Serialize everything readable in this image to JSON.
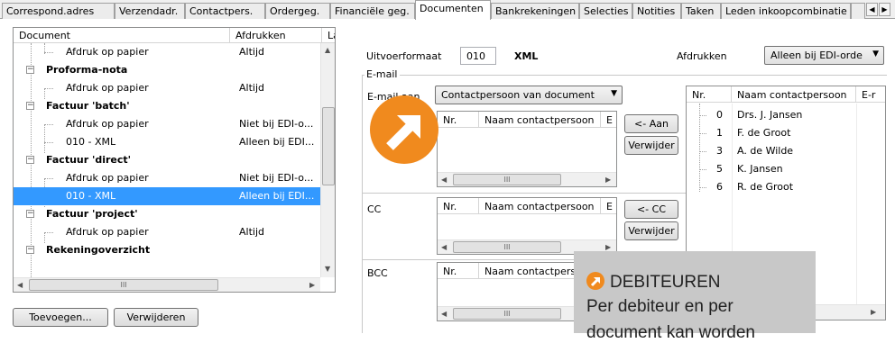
{
  "tabs": [
    "Correspond.adres",
    "Verzendadr.",
    "Contactpers.",
    "Ordergeg.",
    "Financiële geg.",
    "Documenten",
    "Bankrekeningen",
    "Selecties",
    "Notities",
    "Taken",
    "Leden inkoopcombinatie"
  ],
  "active_tab": "Documenten",
  "tree": {
    "headers": {
      "document": "Document",
      "afdrukken": "Afdrukken",
      "la": "La"
    },
    "rows": [
      {
        "label": "Afdruk op papier",
        "value": "Altijd"
      },
      {
        "label": "Proforma-nota",
        "value": ""
      },
      {
        "label": "Afdruk op papier",
        "value": "Altijd"
      },
      {
        "label": "Factuur 'batch'",
        "value": ""
      },
      {
        "label": "Afdruk op papier",
        "value": "Niet bij EDI-o..."
      },
      {
        "label": "010 - XML",
        "value": "Alleen bij EDI..."
      },
      {
        "label": "Factuur 'direct'",
        "value": ""
      },
      {
        "label": "Afdruk op papier",
        "value": "Niet bij EDI-o..."
      },
      {
        "label": "010 - XML",
        "value": "Alleen bij EDI..."
      },
      {
        "label": "Factuur 'project'",
        "value": ""
      },
      {
        "label": "Afdruk op papier",
        "value": "Altijd"
      },
      {
        "label": "Rekeningoverzicht",
        "value": ""
      }
    ]
  },
  "buttons": {
    "toevoegen": "Toevoegen...",
    "verwijderen": "Verwijderen",
    "aan": "<- Aan",
    "verwijder1": "Verwijder",
    "cc": "<- CC",
    "verwijder2": "Verwijder"
  },
  "detail": {
    "uitvoerformaat_label": "Uitvoerformaat",
    "uitvoerformaat_value": "010",
    "uitvoerformaat_name": "XML",
    "afdrukken_label": "Afdrukken",
    "afdrukken_value": "Alleen bij EDI-orde",
    "email_group": "E-mail",
    "email_aan_label": "E-mail aan",
    "email_aan_value": "Contactpersoon van document",
    "cc_label": "CC",
    "bcc_label": "BCC",
    "grid_nr": "Nr.",
    "grid_naam": "Naam contactpersoon",
    "grid_e": "E",
    "grid_naam_bcc": "Naam contactpers",
    "hscroll_glyph": "III"
  },
  "contacts": {
    "headers": {
      "nr": "Nr.",
      "naam": "Naam contactpersoon",
      "email": "E-r"
    },
    "rows": [
      {
        "nr": "0",
        "naam": "Drs. J. Jansen"
      },
      {
        "nr": "1",
        "naam": "F. de Groot"
      },
      {
        "nr": "3",
        "naam": "A. de Wilde"
      },
      {
        "nr": "5",
        "naam": "K. Jansen"
      },
      {
        "nr": "6",
        "naam": "R. de Groot"
      }
    ]
  },
  "callout": {
    "title": "DEBITEUREN",
    "line1": "Per debiteur en per",
    "line2": "document kan worden"
  },
  "colors": {
    "accent": "#f08a1e",
    "selection": "#3399ff",
    "callout_bg": "#c8c8c8"
  }
}
